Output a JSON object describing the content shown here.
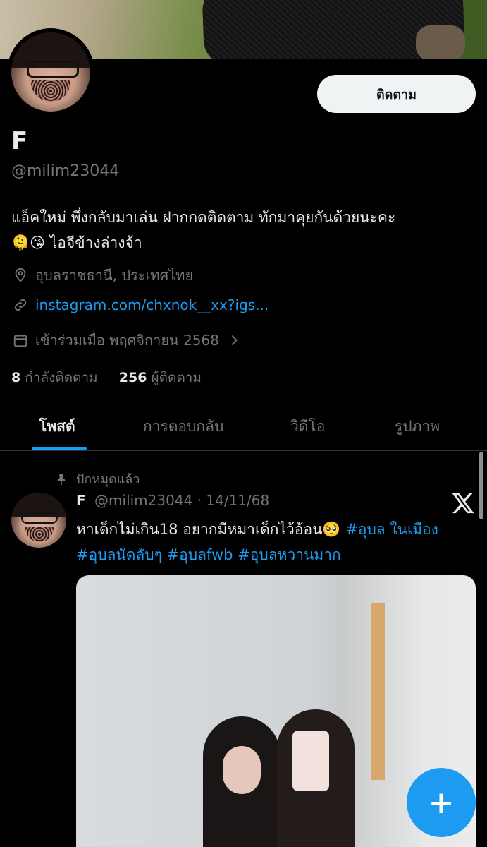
{
  "profile": {
    "follow_label": "ติดตาม",
    "name": "F",
    "handle": "@milim23044",
    "bio_line1": "แอ็คใหม่ พึ่งกลับมาเล่น ฝากกดติดตาม ทักมาคุยกันด้วยนะคะ",
    "bio_line2_emoji": "🫠😘",
    "bio_line2_text": " ไอจีข้างล่างจ้า",
    "location": "อุบลราชธานี, ประเทศไทย",
    "link": "instagram.com/chxnok__xx?igs...",
    "joined": "เข้าร่วมเมื่อ พฤศจิกายน 2568",
    "following_count": "8",
    "following_label": "กำลังติดตาม",
    "followers_count": "256",
    "followers_label": "ผู้ติดตาม"
  },
  "tabs": [
    "โพสต์",
    "การตอบกลับ",
    "วิดีโอ",
    "รูปภาพ"
  ],
  "post": {
    "pinned_label": "ปักหมุดแล้ว",
    "author_name": "F",
    "author_handle": "@milim23044",
    "separator": "·",
    "date": "14/11/68",
    "text": "หาเด็กไม่เกิน18 อยากมีหมาเด็กไว้อ้อน🥺",
    "hashtags": [
      "#อุบล ในเมือง",
      "#อุบลนัดลับๆ",
      "#อุบลfwb",
      "#อุบลหวานมาก"
    ]
  },
  "colors": {
    "accent": "#1d9bf0",
    "muted": "#71767b",
    "text": "#e7e9ea",
    "background": "#000000"
  },
  "icons": {
    "location": "location-pin-icon",
    "link": "link-icon",
    "calendar": "calendar-icon",
    "pin": "pin-icon",
    "x": "x-logo-icon",
    "compose": "plus-icon"
  }
}
